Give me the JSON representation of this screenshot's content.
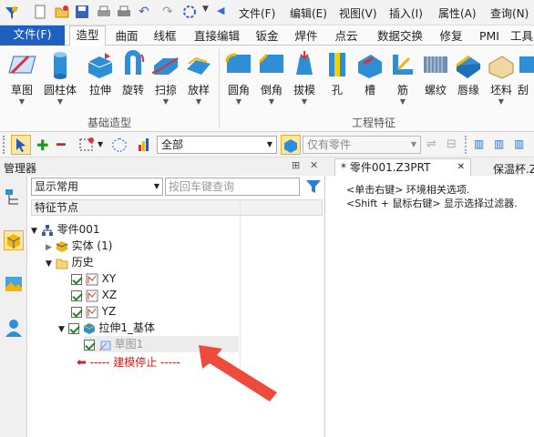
{
  "quick_menu": [
    "文件(F)",
    "编辑(E)",
    "视图(V)",
    "插入(I)",
    "属性(A)",
    "查询(N)"
  ],
  "tabs": [
    {
      "label": "文件(F)",
      "state": "file"
    },
    {
      "label": "造型",
      "state": "active"
    },
    {
      "label": "曲面"
    },
    {
      "label": "线框"
    },
    {
      "label": "直接编辑"
    },
    {
      "label": "钣金"
    },
    {
      "label": "焊件"
    },
    {
      "label": "点云"
    },
    {
      "label": "数据交换"
    },
    {
      "label": "修复"
    },
    {
      "label": "PMI"
    },
    {
      "label": "工具"
    }
  ],
  "ribbon": {
    "basic_buttons": [
      "草图",
      "圆柱体",
      "拉伸",
      "旋转",
      "扫掠",
      "放样"
    ],
    "feature_buttons": [
      "圆角",
      "倒角",
      "拔模",
      "孔",
      "槽",
      "筋",
      "螺纹",
      "唇缘",
      "坯料",
      "刮"
    ],
    "group_basic": "基础造型",
    "group_feature": "工程特征"
  },
  "toolbar": {
    "filter_all": "全部",
    "part_only": "仅有零件"
  },
  "manager": {
    "title": "管理器",
    "pin": "⊞",
    "close": "✕",
    "display_select": "显示常用",
    "search_placeholder": "按回车键查询",
    "column_header": "特征节点"
  },
  "tree": {
    "root": "零件001",
    "solid": "实体 (1)",
    "history": "历史",
    "xy": "XY",
    "xz": "XZ",
    "yz": "YZ",
    "extrude": "拉伸1_基体",
    "sketch": "草图1",
    "stop": "----- 建模停止 -----"
  },
  "doc_tabs": {
    "active": "* 零件001.Z3PRT",
    "active_close": "✕",
    "other": "保温杯.Z"
  },
  "hints": {
    "line1": "<单击右键> 环境相关选项.",
    "line2": "<Shift + 鼠标右键> 显示选择过滤器."
  },
  "colors": {
    "file_tab": "#1f5fbf",
    "accent": "#2f6fd0",
    "arrow": "#ef4b3b",
    "stop_text": "#d02020"
  }
}
